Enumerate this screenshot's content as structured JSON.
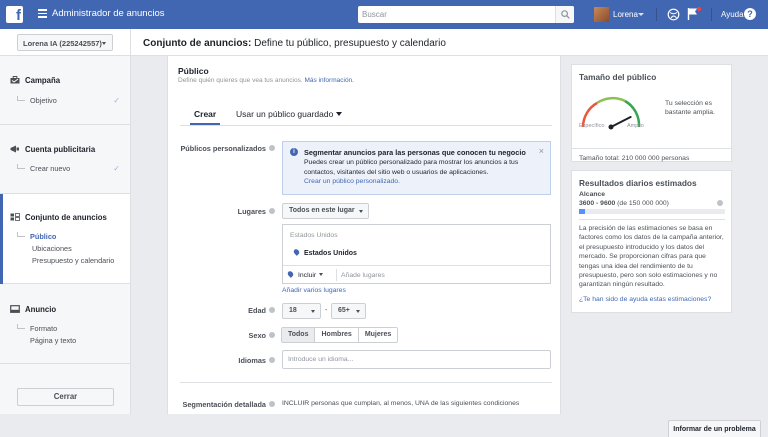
{
  "topbar": {
    "app_title": "Administrador de anuncios",
    "search_placeholder": "Buscar",
    "user_name": "Lorena",
    "help_label": "Ayuda",
    "brand_color": "#4267b2"
  },
  "subheader": {
    "account": "Lorena IA (225242557)",
    "title_bold": "Conjunto de anuncios:",
    "title_rest": " Define tu público, presupuesto y calendario"
  },
  "sidebar": {
    "campaign": {
      "label": "Campaña",
      "icon": "briefcase-icon",
      "sub": [
        "Objetivo"
      ]
    },
    "account": {
      "label": "Cuenta publicitaria",
      "icon": "megaphone-icon",
      "sub": [
        "Crear nuevo"
      ]
    },
    "adset": {
      "label": "Conjunto de anuncios",
      "icon": "grid-icon",
      "sub": [
        "Público",
        "Ubicaciones",
        "Presupuesto y calendario"
      ]
    },
    "ad": {
      "label": "Anuncio",
      "icon": "monitor-icon",
      "sub": [
        "Formato",
        "Página y texto"
      ]
    },
    "close_label": "Cerrar"
  },
  "audience": {
    "title": "Público",
    "description": "Define quién quieres que vea tus anuncios.",
    "more_info": "Más información.",
    "tabs": [
      "Crear",
      "Usar un público guardado"
    ],
    "custom_audiences_label": "Públicos personalizados",
    "info_title": "Segmentar anuncios para las personas que conocen tu negocio",
    "info_body": "Puedes crear un público personalizado para mostrar los anuncios a tus contactos, visitantes del sitio web o usuarios de aplicaciones.",
    "info_link": "Crear un público personalizado.",
    "locations_label": "Lugares",
    "locations_select": "Todos en este lugar",
    "locations_group": "Estados Unidos",
    "locations_item": "Estados Unidos",
    "include_label": "Incluir",
    "add_places_placeholder": "Añade lugares",
    "bulk_link": "Añadir varios lugares",
    "age_label": "Edad",
    "age_min": "18",
    "age_dash": "-",
    "age_max": "65+",
    "gender_label": "Sexo",
    "genders": [
      "Todos",
      "Hombres",
      "Mujeres"
    ],
    "languages_label": "Idiomas",
    "languages_placeholder": "Introduce un idioma...",
    "detailed_label": "Segmentación detallada",
    "detailed_text": "INCLUIR personas que cumplan, al menos, UNA de las siguientes condiciones"
  },
  "audience_size": {
    "title": "Tamaño del público",
    "specific": "Específico",
    "broad": "Amplio",
    "description": "Tu selección es bastante amplia.",
    "total": "Tamaño total: 210 000 000 personas",
    "gauge_level": 0.85
  },
  "daily_results": {
    "title": "Resultados diarios estimados",
    "reach_label": "Alcance",
    "reach_value_bold": "3600 - 9600",
    "reach_value_rest": " (de 150 000 000)",
    "reach_fraction": 0.04,
    "note": "La precisión de las estimaciones se basa en factores como los datos de la campaña anterior, el presupuesto introducido y los datos del mercado. Se proporcionan cifras para que tengas una idea del rendimiento de tu presupuesto, pero son solo estimaciones y no garantizan ningún resultado.",
    "help_link": "¿Te han sido de ayuda estas estimaciones?"
  },
  "report_problem": "Informar de un problema"
}
